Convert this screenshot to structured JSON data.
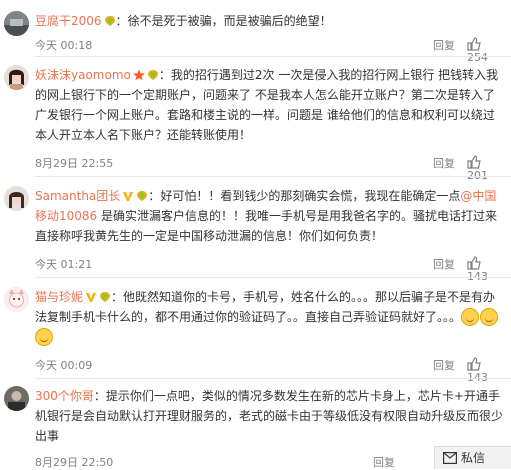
{
  "comments": [
    {
      "user": "豆腐干2006",
      "colon": "：",
      "text": "徐不是死于被骗，而是被骗后的绝望！",
      "time": "今天 00:18",
      "reply": "回复",
      "likes": "254"
    },
    {
      "user": "妖沫沫yaomomo",
      "colon": "：",
      "text": "我的招行遇到过2次 一次是侵入我的招行网上银行 把钱转入我的网上银行下的一个定期账户，问题来了 不是我本人怎么能开立账户？第二次是转入了广发银行一个网上账户。套路和楼主说的一样。问题是 谁给他们的信息和权利可以绕过本人开立本人名下账户？还能转账使用！",
      "time": "8月29日 22:55",
      "reply": "回复",
      "likes": "201"
    },
    {
      "user": "Samantha团长",
      "colon": "：",
      "text_before": "好可怕！！看到钱少的那刻确实会慌，我现在能确定一点",
      "mention": "@中国移动10086",
      "text_after": " 是确实泄漏客户信息的！！我唯一手机号是用我爸名字的。骚扰电话打过来直接称呼我黄先生的一定是中国移动泄漏的信息！你们如何负责！",
      "time": "今天 01:21",
      "reply": "回复",
      "likes": "143"
    },
    {
      "user": "猫与珍妮",
      "colon": "：",
      "text": "他既然知道你的卡号，手机号，姓名什么的。。。那以后骗子是不是有办法复制手机卡什么的，都不用通过你的验证码了。。直接自己弄验证码就好了。。。",
      "time": "今天 00:09",
      "reply": "回复",
      "likes": "143"
    },
    {
      "user": "300个你哥",
      "colon": "：",
      "text": "提示你们一点吧，类似的情况多数发生在新的芯片卡身上，芯片卡+开通手机银行是会自动默认打开理财服务的，老式的磁卡由于等级低没有权限自动升级反而很少出事",
      "time": "8月29日 22:50",
      "reply": "回复"
    }
  ],
  "dm_label": "私信",
  "colors": {
    "username": "#eb7350",
    "meta": "#808080"
  }
}
